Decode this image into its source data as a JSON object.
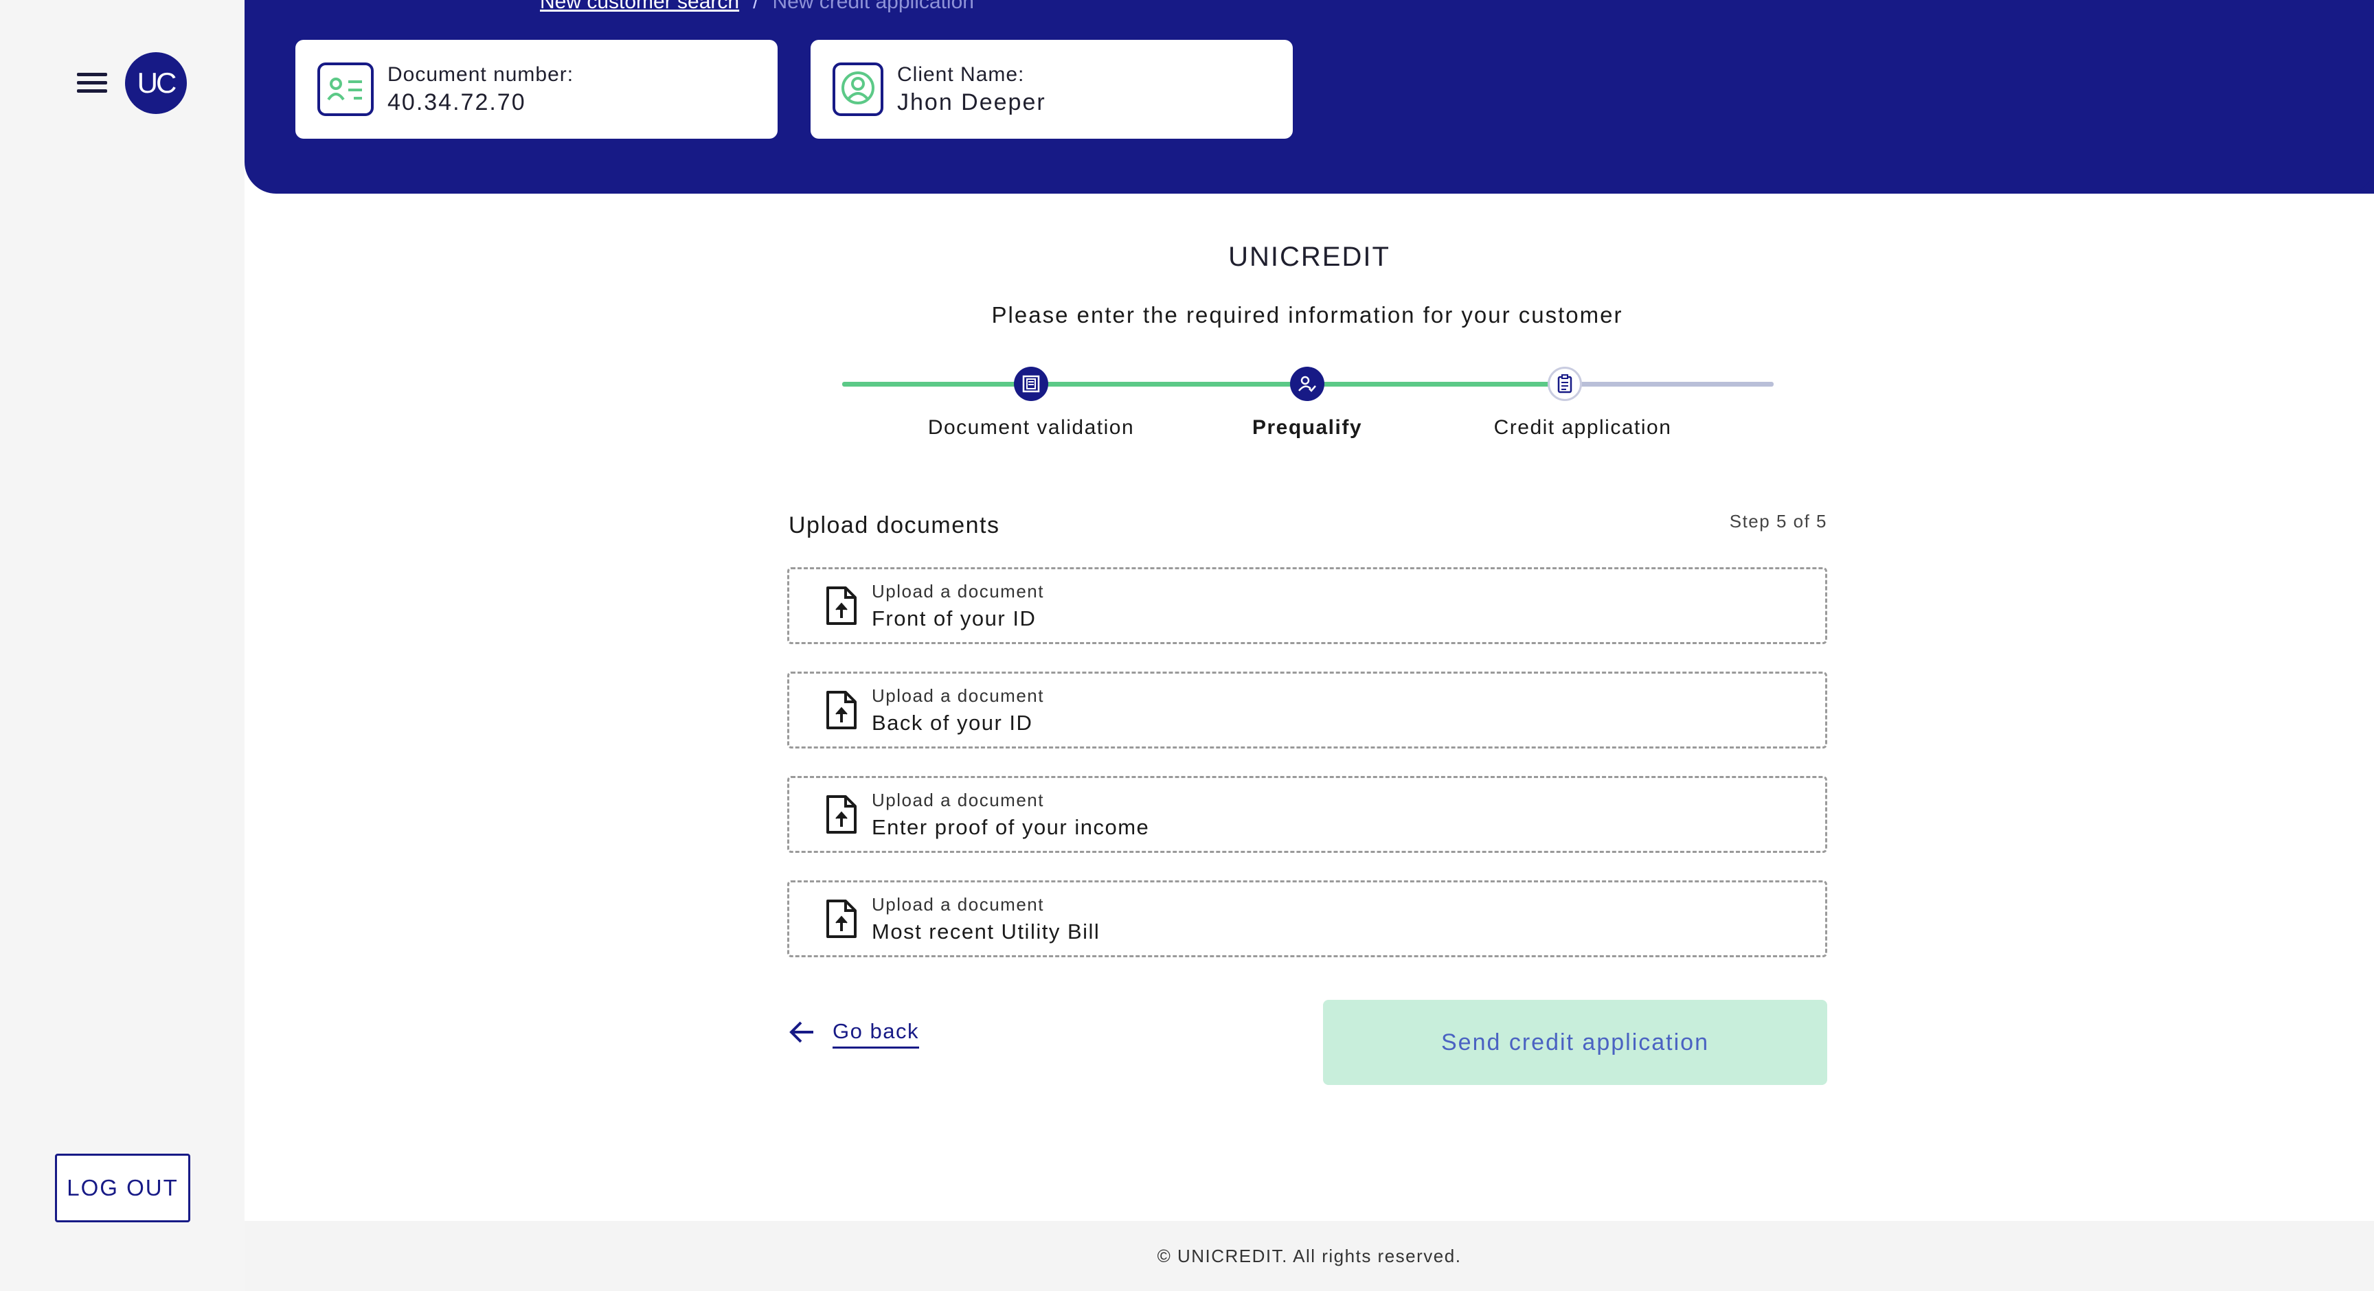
{
  "sidebar": {
    "avatar_initials": "UC",
    "logout_label": "LOG OUT"
  },
  "breadcrumb": {
    "link": "New customer search",
    "separator": "/",
    "current": "New credit application"
  },
  "header": {
    "document_label": "Document number:",
    "document_value": "40.34.72.70",
    "client_label": "Client Name:",
    "client_value": "Jhon Deeper"
  },
  "main": {
    "title": "UNICREDIT",
    "subtitle": "Please enter the required information for your customer",
    "steps": [
      {
        "label": "Document validation",
        "icon": "document-scan-icon",
        "state": "complete"
      },
      {
        "label": "Prequalify",
        "icon": "user-check-icon",
        "state": "active"
      },
      {
        "label": "Credit application",
        "icon": "clipboard-icon",
        "state": "pending"
      }
    ],
    "progress_completed_fraction": 0.776,
    "section_title": "Upload documents",
    "step_count": "Step 5 of 5",
    "uploads": [
      {
        "hint": "Upload a document",
        "label": "Front of your ID"
      },
      {
        "hint": "Upload a document",
        "label": "Back of your ID"
      },
      {
        "hint": "Upload a document",
        "label": "Enter proof of your income"
      },
      {
        "hint": "Upload a document",
        "label": "Most recent Utility Bill"
      }
    ],
    "go_back_label": "Go back",
    "send_label": "Send credit application"
  },
  "footer": {
    "copyright": "© UNICREDIT. All rights reserved."
  },
  "colors": {
    "brand": "#171a86",
    "success": "#5cc987",
    "disabled_button": "#c8eedb"
  }
}
